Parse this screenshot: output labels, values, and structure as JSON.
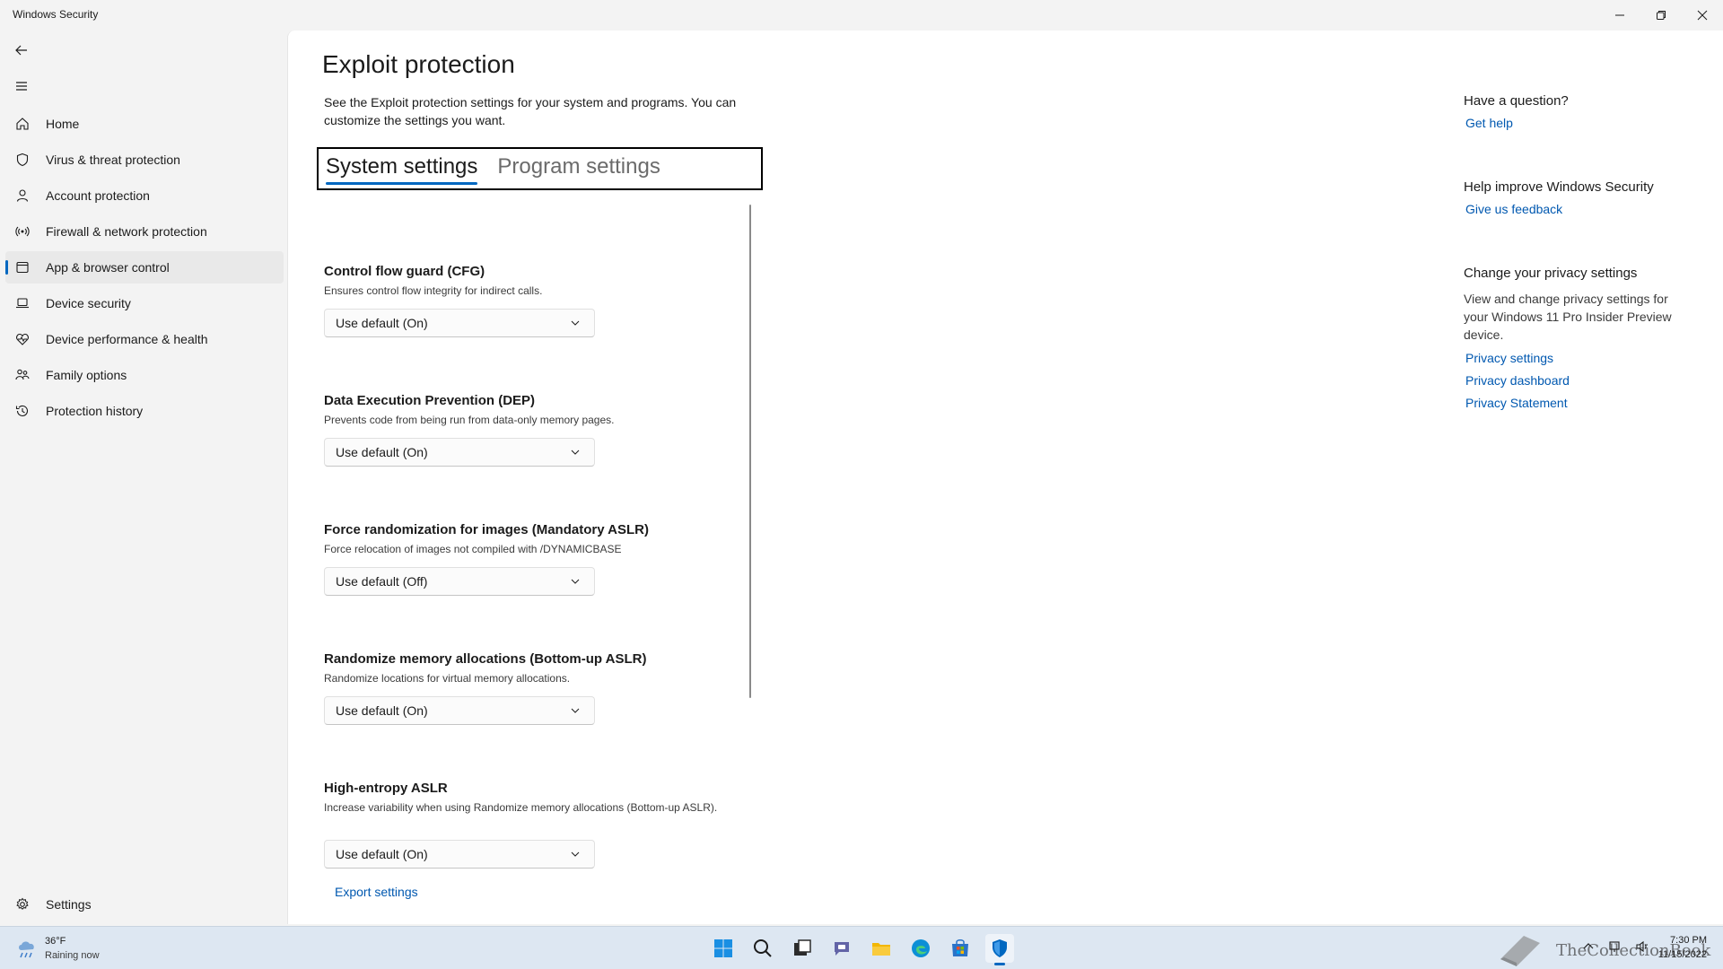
{
  "window": {
    "title": "Windows Security",
    "minimize_icon": "minimize-icon",
    "restore_icon": "restore-icon",
    "close_icon": "close-icon"
  },
  "sidebar": {
    "back_icon": "back-arrow-icon",
    "menu_icon": "hamburger-icon",
    "items": [
      {
        "label": "Home",
        "icon": "home-icon"
      },
      {
        "label": "Virus & threat protection",
        "icon": "shield-icon"
      },
      {
        "label": "Account protection",
        "icon": "person-icon"
      },
      {
        "label": "Firewall & network protection",
        "icon": "wifi-antenna-icon"
      },
      {
        "label": "App & browser control",
        "icon": "app-window-icon",
        "active": true
      },
      {
        "label": "Device security",
        "icon": "laptop-icon"
      },
      {
        "label": "Device performance & health",
        "icon": "heart-pulse-icon"
      },
      {
        "label": "Family options",
        "icon": "family-icon"
      },
      {
        "label": "Protection history",
        "icon": "history-icon"
      }
    ],
    "settings_label": "Settings",
    "settings_icon": "gear-icon"
  },
  "main": {
    "title": "Exploit protection",
    "description": "See the Exploit protection settings for your system and programs.  You can customize the settings you want.",
    "tabs": [
      {
        "label": "System settings",
        "selected": true
      },
      {
        "label": "Program settings",
        "selected": false
      }
    ],
    "settings": [
      {
        "title": "Control flow guard (CFG)",
        "description": "Ensures control flow integrity for indirect calls.",
        "value": "Use default (On)"
      },
      {
        "title": "Data Execution Prevention (DEP)",
        "description": "Prevents code from being run from data-only memory pages.",
        "value": "Use default (On)"
      },
      {
        "title": "Force randomization for images (Mandatory ASLR)",
        "description": "Force relocation of images not compiled with /DYNAMICBASE",
        "value": "Use default (Off)"
      },
      {
        "title": "Randomize memory allocations (Bottom-up ASLR)",
        "description": "Randomize locations for virtual memory allocations.",
        "value": "Use default (On)"
      },
      {
        "title": "High-entropy ASLR",
        "description": "Increase variability when using Randomize memory allocations (Bottom-up ASLR).",
        "value": "Use default (On)"
      }
    ],
    "export_label": "Export settings"
  },
  "right_panel": {
    "question": {
      "heading": "Have a question?",
      "link": "Get help"
    },
    "improve": {
      "heading": "Help improve Windows Security",
      "link": "Give us feedback"
    },
    "privacy": {
      "heading": "Change your privacy settings",
      "text": "View and change privacy settings for your Windows 11 Pro Insider Preview device.",
      "links": [
        "Privacy settings",
        "Privacy dashboard",
        "Privacy Statement"
      ]
    }
  },
  "taskbar": {
    "weather_temp": "36°F",
    "weather_condition": "Raining now",
    "weather_icon": "rain-cloud-icon",
    "apps": [
      "windows-start-icon",
      "search-icon",
      "task-view-icon",
      "chat-icon",
      "file-explorer-icon",
      "edge-icon",
      "store-icon",
      "windows-security-icon"
    ],
    "time": "7:30 PM",
    "date": "11/15/2022",
    "watermark": "TheCollectionBook",
    "accent": "#0067c0"
  }
}
